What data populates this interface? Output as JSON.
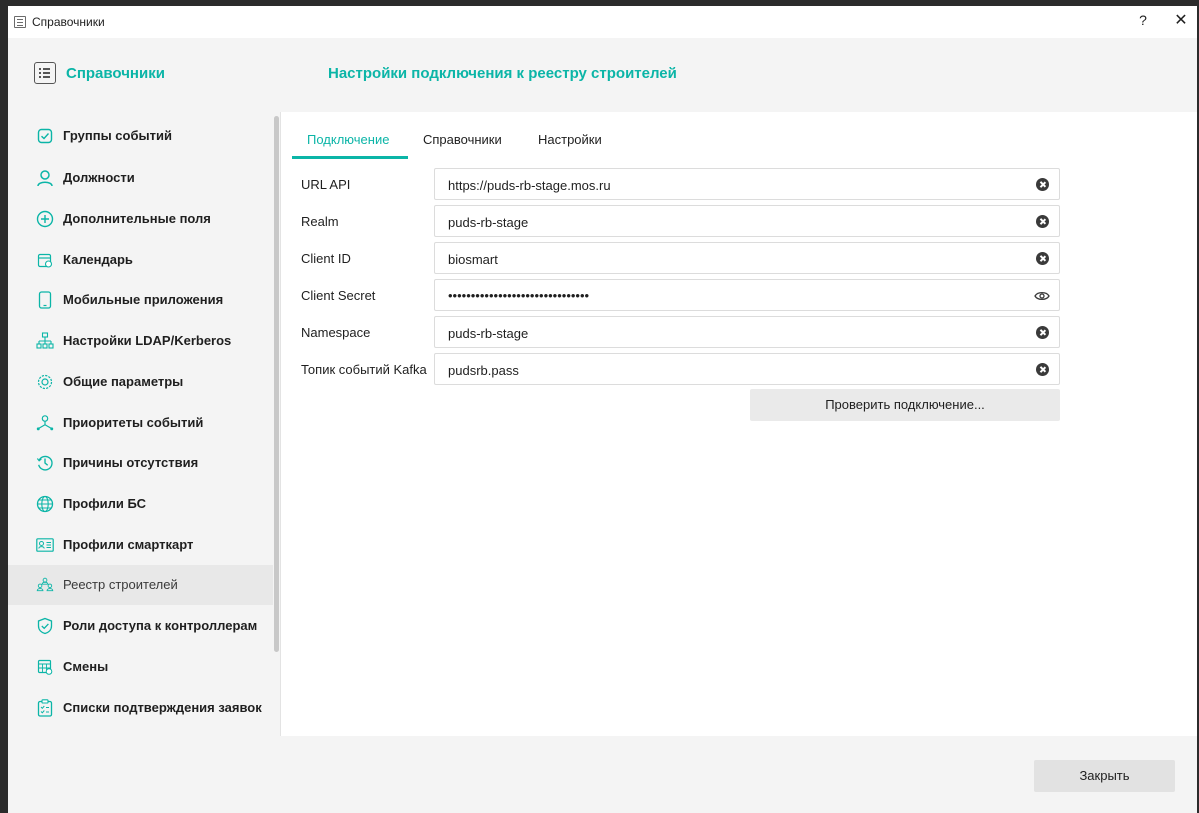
{
  "window": {
    "title": "Справочники",
    "help_glyph": "?",
    "close_glyph": "✕"
  },
  "header": {
    "section_title": "Справочники",
    "page_title": "Настройки подключения к реестру строителей"
  },
  "sidebar": {
    "items": [
      {
        "label": "Группы событий",
        "icon": "checkbox-icon"
      },
      {
        "label": "Должности",
        "icon": "person-icon"
      },
      {
        "label": "Дополнительные поля",
        "icon": "plus-circle-icon"
      },
      {
        "label": "Календарь",
        "icon": "calendar-icon"
      },
      {
        "label": "Мобильные приложения",
        "icon": "phone-icon"
      },
      {
        "label": "Настройки LDAP/Kerberos",
        "icon": "network-icon"
      },
      {
        "label": "Общие параметры",
        "icon": "gear-icon"
      },
      {
        "label": "Приоритеты событий",
        "icon": "hierarchy-icon"
      },
      {
        "label": "Причины отсутствия",
        "icon": "clock-icon"
      },
      {
        "label": "Профили БС",
        "icon": "globe-icon"
      },
      {
        "label": "Профили смарткарт",
        "icon": "id-card-icon"
      },
      {
        "label": "Реестр строителей",
        "icon": "builders-icon",
        "active": true
      },
      {
        "label": "Роли доступа к контроллерам",
        "icon": "shield-icon"
      },
      {
        "label": "Смены",
        "icon": "schedule-icon"
      },
      {
        "label": "Списки подтверждения заявок",
        "icon": "clipboard-icon"
      }
    ]
  },
  "tabs": [
    {
      "label": "Подключение",
      "active": true
    },
    {
      "label": "Справочники"
    },
    {
      "label": "Настройки"
    }
  ],
  "form": {
    "fields": [
      {
        "label": "URL API",
        "value": "https://puds-rb-stage.mos.ru",
        "action": "clear-icon"
      },
      {
        "label": "Realm",
        "value": "puds-rb-stage",
        "action": "clear-icon"
      },
      {
        "label": "Client ID",
        "value": "biosmart",
        "action": "clear-icon"
      },
      {
        "label": "Client Secret",
        "value": "•••••••••••••••••••••••••••••••",
        "action": "eye-icon",
        "masked": true
      },
      {
        "label": "Namespace",
        "value": "puds-rb-stage",
        "action": "clear-icon"
      },
      {
        "label": "Топик событий Kafka",
        "value": "pudsrb.pass",
        "action": "clear-icon"
      }
    ],
    "check_button": "Проверить подключение..."
  },
  "footer": {
    "close_button": "Закрыть"
  },
  "colors": {
    "accent": "#0bb5a7",
    "panel": "#f4f4f4"
  }
}
